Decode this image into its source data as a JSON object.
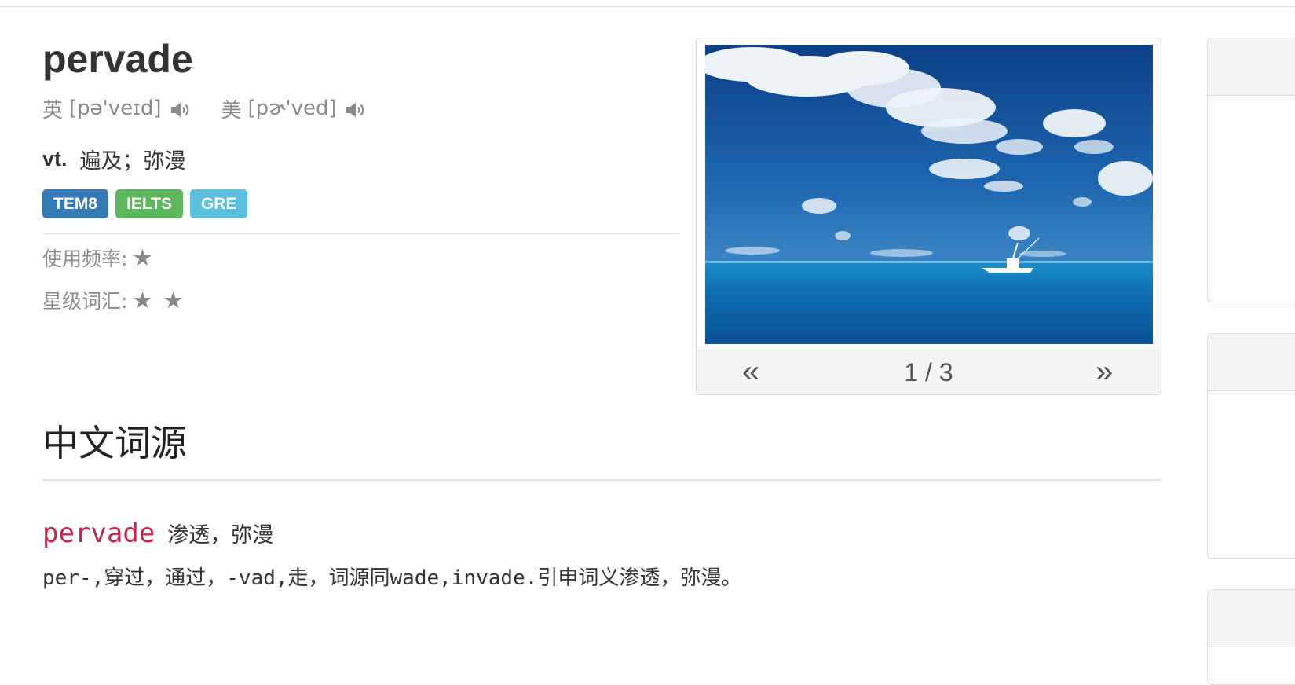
{
  "word": "pervade",
  "pronunciations": [
    {
      "region": "英",
      "ipa": "[pə'veɪd]",
      "icon": "speaker-icon"
    },
    {
      "region": "美",
      "ipa": "[pɚ'ved]",
      "icon": "speaker-icon"
    }
  ],
  "definition": {
    "pos": "vt.",
    "meaning": "遍及；弥漫"
  },
  "tags": [
    {
      "label": "TEM8",
      "color": "#337ab7"
    },
    {
      "label": "IELTS",
      "color": "#5cb85c"
    },
    {
      "label": "GRE",
      "color": "#5bc0de"
    }
  ],
  "frequency": {
    "label": "使用频率:",
    "stars": "★"
  },
  "star_level": {
    "label": "星级词汇:",
    "stars": "★ ★"
  },
  "carousel": {
    "prev": "«",
    "next": "»",
    "counter": "1 / 3",
    "image": "sea-with-boat-and-clouds"
  },
  "etymology": {
    "title": "中文词源",
    "word": "pervade",
    "gloss": "渗透，弥漫",
    "explanation": "per-,穿过，通过，-vad,走，词源同wade,invade.引申词义渗透，弥漫。"
  }
}
